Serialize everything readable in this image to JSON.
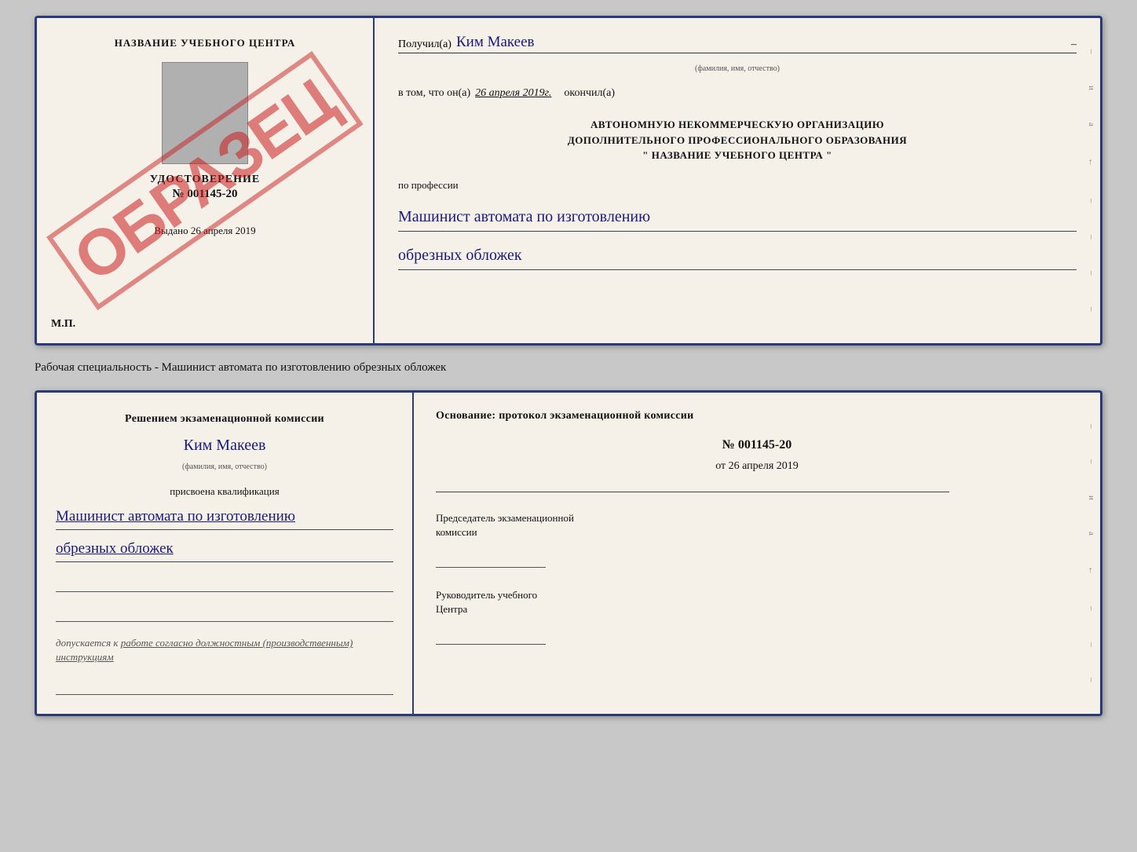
{
  "page": {
    "background": "#c8c8c8"
  },
  "card1": {
    "left": {
      "school_name": "НАЗВАНИЕ УЧЕБНОГО ЦЕНТРА",
      "udostoverenie_label": "УДОСТОВЕРЕНИЕ",
      "doc_number": "№ 001145-20",
      "vydano_text": "Выдано",
      "vydano_date": "26 апреля 2019",
      "mp_label": "М.П.",
      "watermark": "ОБРАЗЕЦ"
    },
    "right": {
      "poluchil_label": "Получил(а)",
      "recipient_name": "Ким Макеев",
      "fio_sub": "(фамилия, имя, отчество)",
      "dash": "–",
      "vtom_label": "в том, что он(а)",
      "vtom_date": "26 апреля 2019г.",
      "okonchil_label": "окончил(а)",
      "org_line1": "АВТОНОМНУЮ НЕКОММЕРЧЕСКУЮ ОРГАНИЗАЦИЮ",
      "org_line2": "ДОПОЛНИТЕЛЬНОГО ПРОФЕССИОНАЛЬНОГО ОБРАЗОВАНИЯ",
      "org_line3": "\"    НАЗВАНИЕ УЧЕБНОГО ЦЕНТРА    \"",
      "po_professii_label": "по профессии",
      "profession_line1": "Машинист автомата по изготовлению",
      "profession_line2": "обрезных обложек"
    }
  },
  "middle_text": "Рабочая специальность - Машинист автомата по изготовлению обрезных обложек",
  "card2": {
    "left": {
      "resheniem_line1": "Решением экзаменационной комиссии",
      "name": "Ким Макеев",
      "fio_sub": "(фамилия, имя, отчество)",
      "prisvoena_label": "присвоена квалификация",
      "qualification_line1": "Машинист автомата по изготовлению",
      "qualification_line2": "обрезных обложек",
      "dopuskaetsya_text": "допускается к",
      "dopuskaetsya_link": "работе согласно должностным (производственным) инструкциям"
    },
    "right": {
      "osnovanie_label": "Основание: протокол экзаменационной комиссии",
      "protocol_number": "№  001145-20",
      "ot_date": "от 26 апреля 2019",
      "predsedatel_line1": "Председатель экзаменационной",
      "predsedatel_line2": "комиссии",
      "rukovoditel_line1": "Руководитель учебного",
      "rukovoditel_line2": "Центра"
    }
  },
  "edge_marks": [
    "-",
    "и",
    "а",
    "←",
    "-",
    "-",
    "-",
    "-"
  ]
}
